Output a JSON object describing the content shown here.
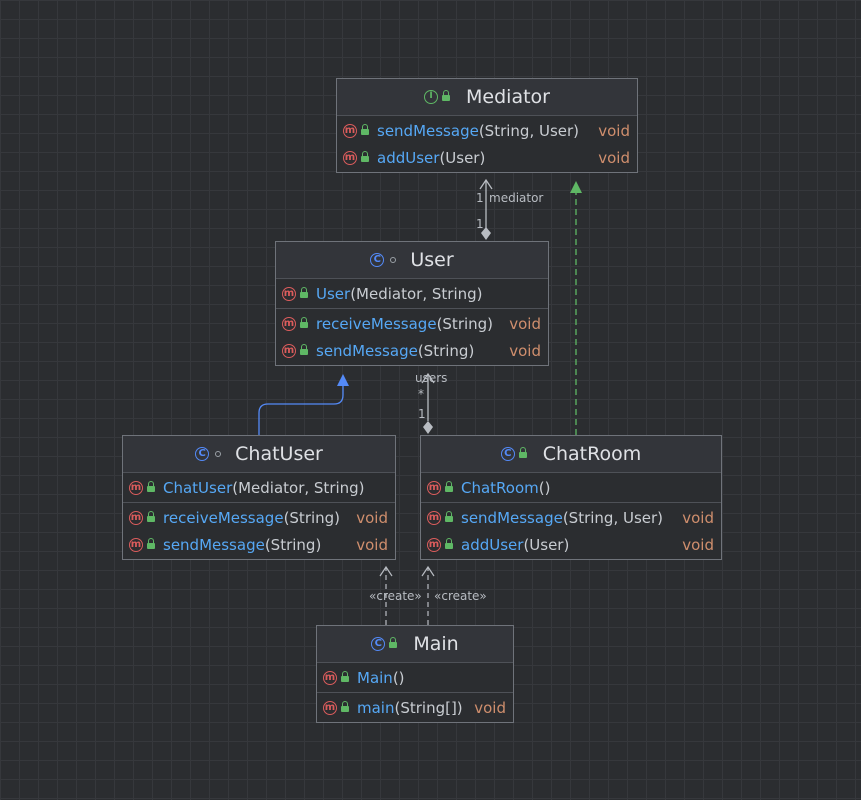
{
  "nodes": {
    "mediator": {
      "title": "Mediator",
      "kind": "interface",
      "sections": [
        [
          {
            "name": "sendMessage",
            "params": "(String, User)",
            "ret": "void"
          },
          {
            "name": "addUser",
            "params": "(User)",
            "ret": "void"
          }
        ]
      ]
    },
    "user": {
      "title": "User",
      "kind": "class",
      "sections": [
        [
          {
            "name": "User",
            "params": "(Mediator, String)",
            "ret": ""
          }
        ],
        [
          {
            "name": "receiveMessage",
            "params": "(String)",
            "ret": "void"
          },
          {
            "name": "sendMessage",
            "params": "(String)",
            "ret": "void"
          }
        ]
      ]
    },
    "chatuser": {
      "title": "ChatUser",
      "kind": "class",
      "sections": [
        [
          {
            "name": "ChatUser",
            "params": "(Mediator, String)",
            "ret": ""
          }
        ],
        [
          {
            "name": "receiveMessage",
            "params": "(String)",
            "ret": "void"
          },
          {
            "name": "sendMessage",
            "params": "(String)",
            "ret": "void"
          }
        ]
      ]
    },
    "chatroom": {
      "title": "ChatRoom",
      "kind": "class",
      "sections": [
        [
          {
            "name": "ChatRoom",
            "params": "()",
            "ret": ""
          }
        ],
        [
          {
            "name": "sendMessage",
            "params": "(String, User)",
            "ret": "void"
          },
          {
            "name": "addUser",
            "params": "(User)",
            "ret": "void"
          }
        ]
      ]
    },
    "main": {
      "title": "Main",
      "kind": "class",
      "sections": [
        [
          {
            "name": "Main",
            "params": "()",
            "ret": ""
          }
        ],
        [
          {
            "name": "main",
            "params": "(String[])",
            "ret": "void"
          }
        ]
      ]
    }
  },
  "edge_labels": {
    "mediator_role": "mediator",
    "mediator_mult_top": "1",
    "mediator_mult_bottom": "1",
    "users_role": "users",
    "users_mult_top": "*",
    "users_mult_bottom": "1",
    "create_left": "«create»",
    "create_right": "«create»"
  },
  "icons": {
    "method": "m",
    "class": "C",
    "interface": "I"
  },
  "colors": {
    "background": "#2b2d30",
    "method_name": "#56a8f5",
    "return_type": "#cf8e6d",
    "method_icon": "#db5c5c",
    "class_icon": "#548af7",
    "interface_icon": "#5fb865",
    "generalization_edge": "#548af7",
    "realization_edge": "#5fb865"
  }
}
